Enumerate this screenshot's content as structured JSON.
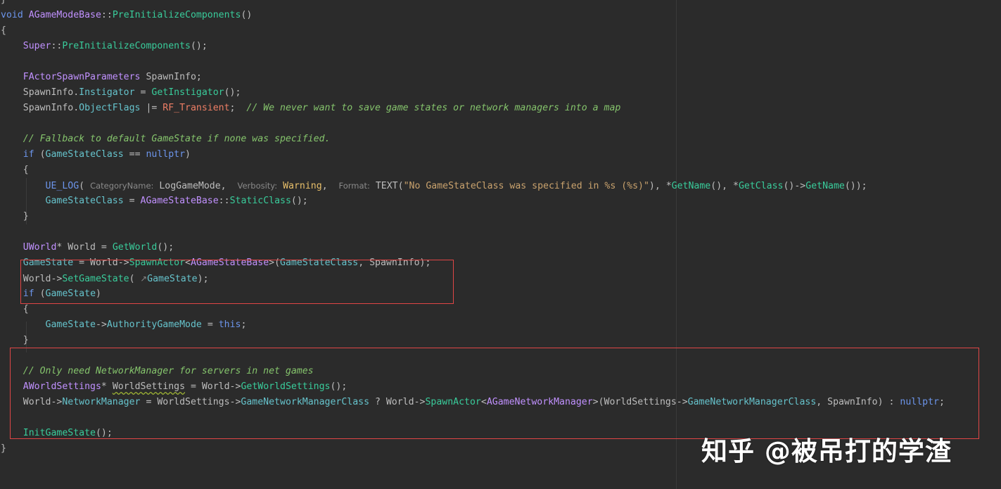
{
  "editor": {
    "lines": [
      {
        "tokens": [
          {
            "c": "t-txt",
            "t": "}"
          }
        ]
      },
      {
        "tokens": [
          {
            "c": "t-kw",
            "t": "void "
          },
          {
            "c": "t-type",
            "t": "AGameModeBase"
          },
          {
            "c": "t-txt",
            "t": "::"
          },
          {
            "c": "t-fn",
            "t": "PreInitializeComponents"
          },
          {
            "c": "t-txt",
            "t": "()"
          }
        ]
      },
      {
        "tokens": [
          {
            "c": "t-txt",
            "t": "{"
          }
        ]
      },
      {
        "tokens": [
          {
            "c": "t-txt",
            "t": "    "
          },
          {
            "c": "t-type",
            "t": "Super"
          },
          {
            "c": "t-txt",
            "t": "::"
          },
          {
            "c": "t-fn",
            "t": "PreInitializeComponents"
          },
          {
            "c": "t-txt",
            "t": "();"
          }
        ]
      },
      {
        "tokens": []
      },
      {
        "tokens": [
          {
            "c": "t-txt",
            "t": "    "
          },
          {
            "c": "t-type",
            "t": "FActorSpawnParameters"
          },
          {
            "c": "t-txt",
            "t": " SpawnInfo;"
          }
        ]
      },
      {
        "tokens": [
          {
            "c": "t-txt",
            "t": "    SpawnInfo."
          },
          {
            "c": "t-field",
            "t": "Instigator"
          },
          {
            "c": "t-txt",
            "t": " = "
          },
          {
            "c": "t-fn",
            "t": "GetInstigator"
          },
          {
            "c": "t-txt",
            "t": "();"
          }
        ]
      },
      {
        "tokens": [
          {
            "c": "t-txt",
            "t": "    SpawnInfo."
          },
          {
            "c": "t-field",
            "t": "ObjectFlags"
          },
          {
            "c": "t-txt",
            "t": " |= "
          },
          {
            "c": "t-const",
            "t": "RF_Transient"
          },
          {
            "c": "t-txt",
            "t": ";  "
          },
          {
            "c": "t-cm",
            "t": "// We never want to save game states or network managers into a map"
          }
        ]
      },
      {
        "tokens": []
      },
      {
        "tokens": [
          {
            "c": "t-txt",
            "t": "    "
          },
          {
            "c": "t-cm",
            "t": "// Fallback to default GameState if none was specified."
          }
        ]
      },
      {
        "tokens": [
          {
            "c": "t-txt",
            "t": "    "
          },
          {
            "c": "t-kw",
            "t": "if"
          },
          {
            "c": "t-txt",
            "t": " ("
          },
          {
            "c": "t-field",
            "t": "GameStateClass"
          },
          {
            "c": "t-txt",
            "t": " == "
          },
          {
            "c": "t-kw",
            "t": "nullptr"
          },
          {
            "c": "t-txt",
            "t": ")"
          }
        ]
      },
      {
        "tokens": [
          {
            "c": "t-txt",
            "t": "    {"
          }
        ]
      },
      {
        "tokens": [
          {
            "c": "t-txt",
            "t": "        "
          },
          {
            "c": "t-macro",
            "t": "UE_LOG"
          },
          {
            "c": "t-txt",
            "t": "( "
          },
          {
            "c": "hint",
            "t": "CategoryName:"
          },
          {
            "c": "t-txt",
            "t": " LogGameMode,  "
          },
          {
            "c": "hint",
            "t": "Verbosity:"
          },
          {
            "c": "t-warn",
            "t": " Warning"
          },
          {
            "c": "t-txt",
            "t": ",  "
          },
          {
            "c": "hint",
            "t": "Format:"
          },
          {
            "c": "t-txt",
            "t": " TEXT("
          },
          {
            "c": "t-str",
            "t": "\"No GameStateClass was specified in %s (%s)\""
          },
          {
            "c": "t-txt",
            "t": "), *"
          },
          {
            "c": "t-fn",
            "t": "GetName"
          },
          {
            "c": "t-txt",
            "t": "(), *"
          },
          {
            "c": "t-fn",
            "t": "GetClass"
          },
          {
            "c": "t-txt",
            "t": "()->"
          },
          {
            "c": "t-fn",
            "t": "GetName"
          },
          {
            "c": "t-txt",
            "t": "());"
          }
        ]
      },
      {
        "tokens": [
          {
            "c": "t-txt",
            "t": "        "
          },
          {
            "c": "t-field",
            "t": "GameStateClass"
          },
          {
            "c": "t-txt",
            "t": " = "
          },
          {
            "c": "t-type",
            "t": "AGameStateBase"
          },
          {
            "c": "t-txt",
            "t": "::"
          },
          {
            "c": "t-fn",
            "t": "StaticClass"
          },
          {
            "c": "t-txt",
            "t": "();"
          }
        ]
      },
      {
        "tokens": [
          {
            "c": "t-txt",
            "t": "    }"
          }
        ]
      },
      {
        "tokens": []
      },
      {
        "tokens": [
          {
            "c": "t-txt",
            "t": "    "
          },
          {
            "c": "t-type",
            "t": "UWorld"
          },
          {
            "c": "t-txt",
            "t": "* World = "
          },
          {
            "c": "t-fn",
            "t": "GetWorld"
          },
          {
            "c": "t-txt",
            "t": "();"
          }
        ]
      },
      {
        "tokens": [
          {
            "c": "t-txt",
            "t": "    "
          },
          {
            "c": "t-field",
            "t": "GameState"
          },
          {
            "c": "t-txt",
            "t": " = World->"
          },
          {
            "c": "t-fn",
            "t": "SpawnActor"
          },
          {
            "c": "t-txt",
            "t": "<"
          },
          {
            "c": "t-type",
            "t": "AGameStateBase"
          },
          {
            "c": "t-txt",
            "t": ">("
          },
          {
            "c": "t-field",
            "t": "GameStateClass"
          },
          {
            "c": "t-txt",
            "t": ", SpawnInfo);"
          }
        ]
      },
      {
        "tokens": [
          {
            "c": "t-txt",
            "t": "    World->"
          },
          {
            "c": "t-fn",
            "t": "SetGameState"
          },
          {
            "c": "t-txt",
            "t": "( "
          },
          {
            "c": "hint",
            "t": "↗"
          },
          {
            "c": "t-field",
            "t": "GameState"
          },
          {
            "c": "t-txt",
            "t": ");"
          }
        ]
      },
      {
        "tokens": [
          {
            "c": "t-txt",
            "t": "    "
          },
          {
            "c": "t-kw",
            "t": "if"
          },
          {
            "c": "t-txt",
            "t": " ("
          },
          {
            "c": "t-field",
            "t": "GameState"
          },
          {
            "c": "t-txt",
            "t": ")"
          }
        ]
      },
      {
        "tokens": [
          {
            "c": "t-txt",
            "t": "    {"
          }
        ]
      },
      {
        "tokens": [
          {
            "c": "t-txt",
            "t": "        "
          },
          {
            "c": "t-field",
            "t": "GameState"
          },
          {
            "c": "t-txt",
            "t": "->"
          },
          {
            "c": "t-field",
            "t": "AuthorityGameMode"
          },
          {
            "c": "t-txt",
            "t": " = "
          },
          {
            "c": "t-kw",
            "t": "this"
          },
          {
            "c": "t-txt",
            "t": ";"
          }
        ]
      },
      {
        "tokens": [
          {
            "c": "t-txt",
            "t": "    }"
          }
        ]
      },
      {
        "tokens": []
      },
      {
        "tokens": [
          {
            "c": "t-txt",
            "t": "    "
          },
          {
            "c": "t-cm",
            "t": "// Only need NetworkManager for servers in net games"
          }
        ]
      },
      {
        "tokens": [
          {
            "c": "t-txt",
            "t": "    "
          },
          {
            "c": "t-type",
            "t": "AWorldSettings"
          },
          {
            "c": "t-txt",
            "t": "* "
          },
          {
            "c": "t-txt squiggle",
            "t": "WorldSettings"
          },
          {
            "c": "t-txt",
            "t": " = World->"
          },
          {
            "c": "t-fn",
            "t": "GetWorldSettings"
          },
          {
            "c": "t-txt",
            "t": "();"
          }
        ]
      },
      {
        "tokens": [
          {
            "c": "t-txt",
            "t": "    World->"
          },
          {
            "c": "t-field",
            "t": "NetworkManager"
          },
          {
            "c": "t-txt",
            "t": " = WorldSettings->"
          },
          {
            "c": "t-field",
            "t": "GameNetworkManagerClass"
          },
          {
            "c": "t-txt",
            "t": " ? World->"
          },
          {
            "c": "t-fn",
            "t": "SpawnActor"
          },
          {
            "c": "t-txt",
            "t": "<"
          },
          {
            "c": "t-type",
            "t": "AGameNetworkManager"
          },
          {
            "c": "t-txt",
            "t": ">(WorldSettings->"
          },
          {
            "c": "t-field",
            "t": "GameNetworkManagerClass"
          },
          {
            "c": "t-txt",
            "t": ", SpawnInfo) : "
          },
          {
            "c": "t-kw",
            "t": "nullptr"
          },
          {
            "c": "t-txt",
            "t": ";"
          }
        ]
      },
      {
        "tokens": []
      },
      {
        "tokens": [
          {
            "c": "t-txt",
            "t": "    "
          },
          {
            "c": "t-fn",
            "t": "InitGameState"
          },
          {
            "c": "t-txt",
            "t": "();"
          }
        ]
      },
      {
        "tokens": [
          {
            "c": "t-txt",
            "t": "}"
          }
        ]
      }
    ]
  },
  "watermark": {
    "text": "知乎 @被吊打的学渣"
  },
  "colors": {
    "background": "#2b2b2b",
    "highlight_box": "#e04646",
    "keyword": "#6c95eb",
    "type": "#c191ff",
    "function": "#39cc9b",
    "field": "#66c3cc",
    "comment": "#85c46c",
    "string": "#c9a26d"
  }
}
